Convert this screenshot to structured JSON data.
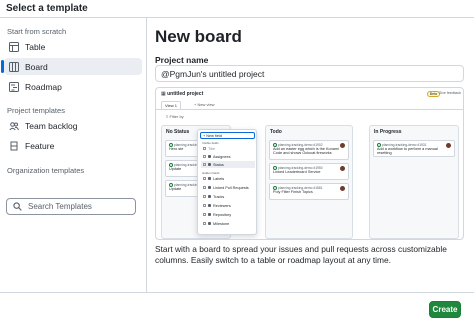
{
  "dialog_title": "Select a template",
  "sidebar": {
    "scratch_label": "Start from scratch",
    "scratch_items": [
      {
        "label": "Table",
        "icon": "table-icon"
      },
      {
        "label": "Board",
        "icon": "board-icon",
        "active": true
      },
      {
        "label": "Roadmap",
        "icon": "roadmap-icon"
      }
    ],
    "project_label": "Project templates",
    "project_items": [
      {
        "label": "Team backlog",
        "icon": "team-icon"
      },
      {
        "label": "Feature",
        "icon": "feature-icon"
      }
    ],
    "org_label": "Organization templates",
    "search_placeholder": "Search Templates"
  },
  "main": {
    "title": "New board",
    "field_label": "Project name",
    "project_name": "@PgmJun's untitled project",
    "description": "Start with a board to spread your issues and pull requests across customizable columns. Easily switch to a table or roadmap layout at any time."
  },
  "preview": {
    "project_title": "untitled project",
    "tabs": [
      "View 1",
      "+ New view"
    ],
    "beta_label": "Beta",
    "feedback_label": "Give feedback",
    "filter_label": "Filter by",
    "columns": [
      {
        "title": "No Status",
        "cards": [
          {
            "meta": "planning-tracking-demo",
            "text": "Hero ste"
          },
          {
            "meta": "planning-tracking-demo",
            "text": "Update"
          },
          {
            "meta": "planning-tracking-demo",
            "text": "Update"
          }
        ]
      },
      {
        "title": "Todo",
        "cards": [
          {
            "meta": "planning-tracking-demo #1902",
            "text": "Add an easter egg which is the Konami Code and shows Octocat fireworks"
          },
          {
            "meta": "planning-tracking-demo #1950",
            "text": "Linked Leaderboard Service"
          },
          {
            "meta": "planning-tracking-demo #1881",
            "text": "Poly Filter Finish Topics"
          }
        ]
      },
      {
        "title": "In Progress",
        "cards": [
          {
            "meta": "planning-tracking-demo #1931",
            "text": "Add a workflow to perform a manual resetting"
          }
        ]
      }
    ],
    "menu": {
      "new_field": "+ New field",
      "visible_label": "Visible fields",
      "visible_items": [
        "Title",
        "Assignees",
        "Status"
      ],
      "hidden_label": "Hidden fields",
      "hidden_items": [
        "Labels",
        "Linked Pull Requests",
        "Tracks",
        "Reviewers",
        "Repository",
        "Milestone"
      ]
    }
  },
  "footer": {
    "create_label": "Create"
  },
  "colors": {
    "accent": "#0969da",
    "create_button": "#1f883d",
    "border": "#d0d7de"
  }
}
